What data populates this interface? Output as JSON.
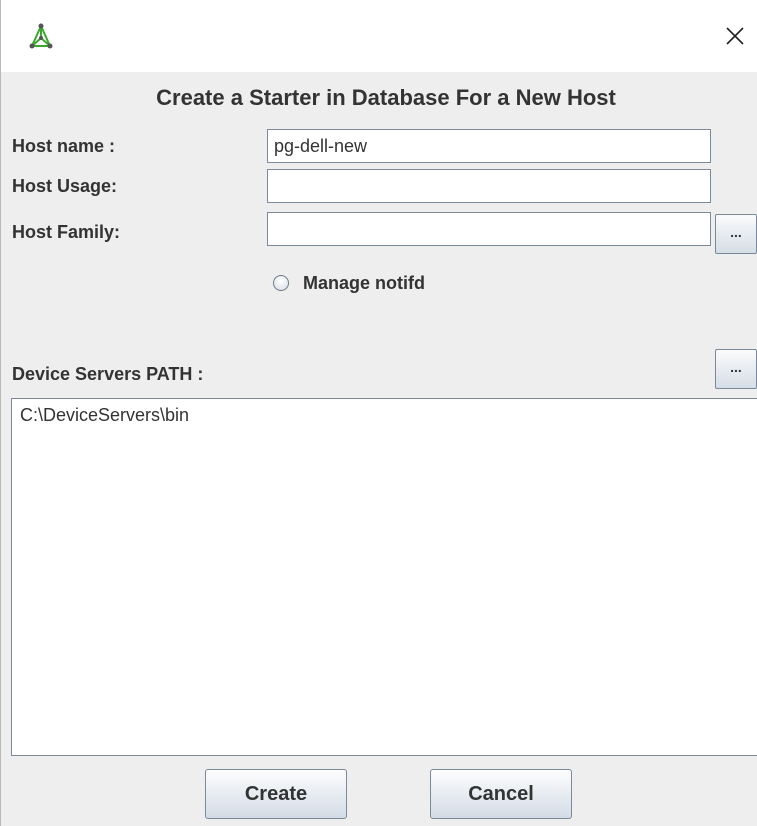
{
  "window": {
    "icon": "starter-app-icon",
    "close_glyph": "✕"
  },
  "dialog": {
    "title": "Create a Starter in Database For a New Host"
  },
  "form": {
    "host_name": {
      "label": "Host name :",
      "value": "pg-dell-new"
    },
    "host_usage": {
      "label": "Host Usage:",
      "value": ""
    },
    "host_family": {
      "label": "Host Family:",
      "value": "",
      "browse_label": "..."
    },
    "manage_notifd": {
      "label": "Manage notifd",
      "checked": false
    },
    "device_servers_path": {
      "label": "Device Servers PATH :",
      "browse_label": "...",
      "value": "C:\\DeviceServers\\bin"
    }
  },
  "buttons": {
    "create": "Create",
    "cancel": "Cancel"
  },
  "colors": {
    "window_bg": "#eeeeee",
    "titlebar_bg": "#ffffff",
    "border": "#7a8a99",
    "text": "#333333",
    "icon_green": "#3aa82b"
  }
}
